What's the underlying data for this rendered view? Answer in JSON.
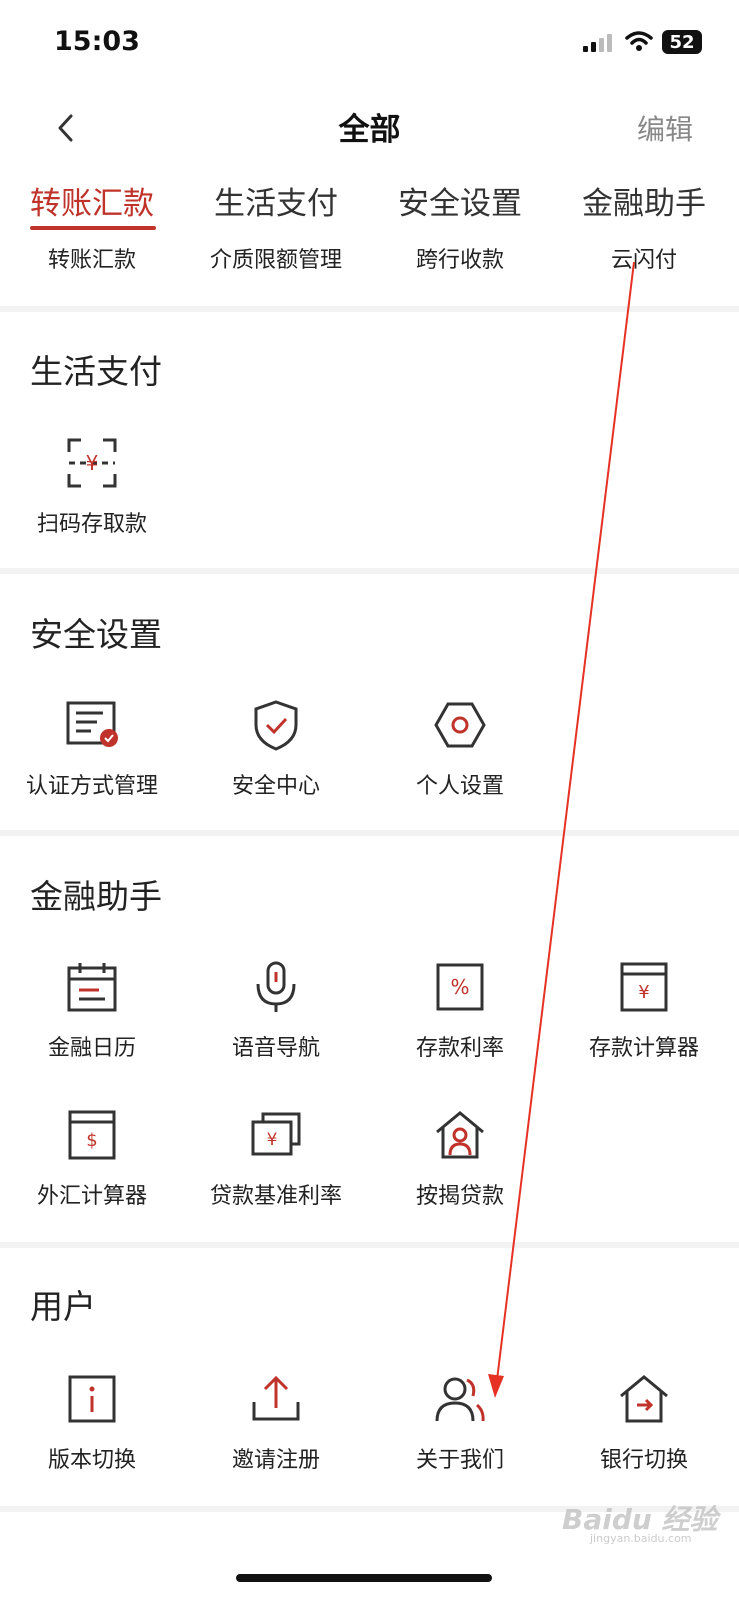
{
  "status": {
    "time": "15:03",
    "battery": "52"
  },
  "navbar": {
    "title": "全部",
    "edit": "编辑"
  },
  "tabs": [
    {
      "label": "转账汇款",
      "active": true
    },
    {
      "label": "生活支付",
      "active": false
    },
    {
      "label": "安全设置",
      "active": false
    },
    {
      "label": "金融助手",
      "active": false
    }
  ],
  "transfer_row": [
    "转账汇款",
    "介质限额管理",
    "跨行收款",
    "云闪付"
  ],
  "sections": {
    "life": {
      "title": "生活支付",
      "items": [
        "扫码存取款"
      ]
    },
    "security": {
      "title": "安全设置",
      "items": [
        "认证方式管理",
        "安全中心",
        "个人设置"
      ]
    },
    "finance": {
      "title": "金融助手",
      "items": [
        "金融日历",
        "语音导航",
        "存款利率",
        "存款计算器",
        "外汇计算器",
        "贷款基准利率",
        "按揭贷款"
      ]
    },
    "user": {
      "title": "用户",
      "items": [
        "版本切换",
        "邀请注册",
        "关于我们",
        "银行切换"
      ]
    }
  },
  "watermark": {
    "text": "Baidu 经验",
    "sub": "jingyan.baidu.com"
  },
  "colors": {
    "accent": "#c0332b",
    "annotation_arrow": "#e53224"
  }
}
